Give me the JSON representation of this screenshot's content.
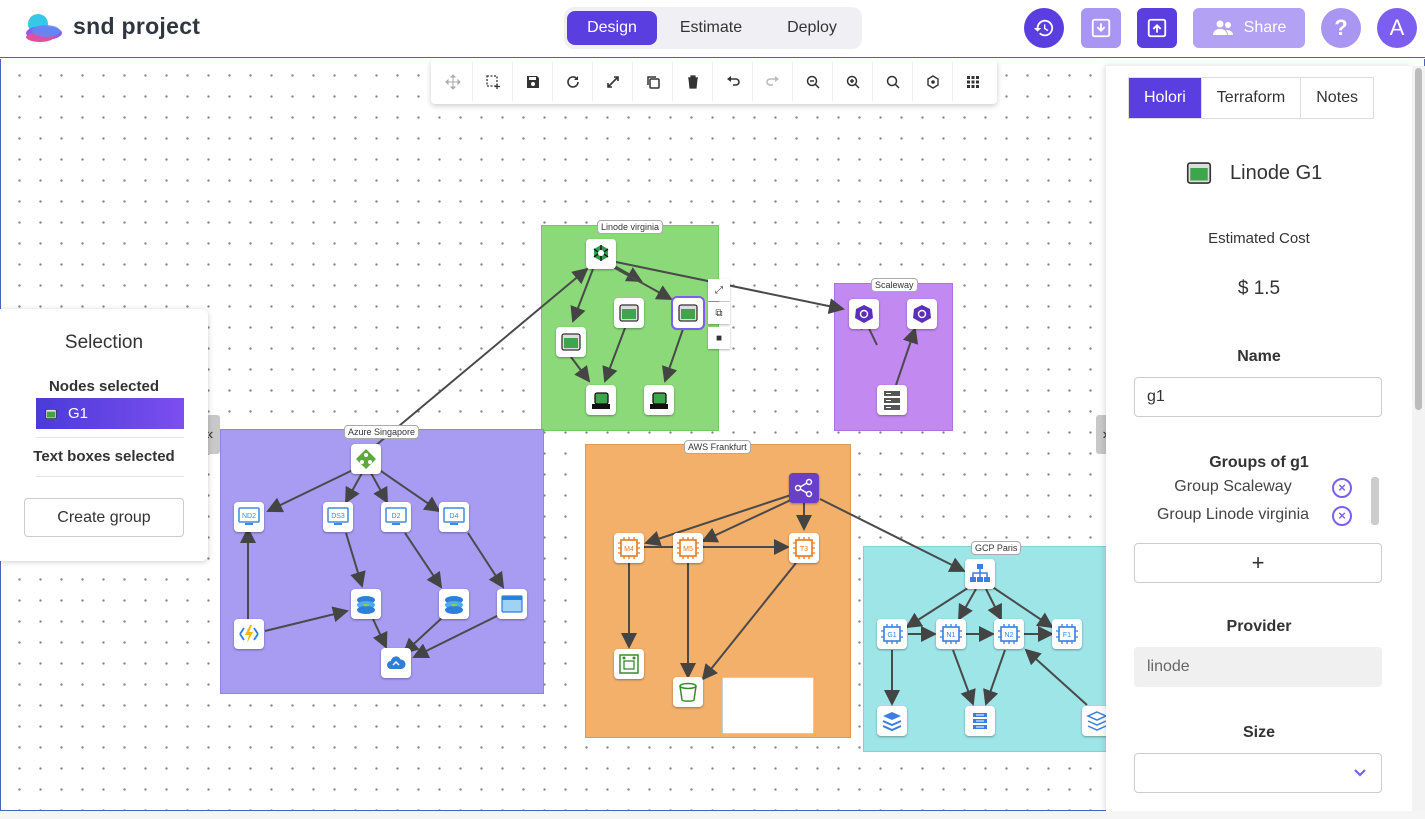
{
  "header": {
    "app_title": "snd project",
    "modes": [
      "Design",
      "Estimate",
      "Deploy"
    ],
    "active_mode": "Design",
    "share_label": "Share",
    "help_label": "?",
    "avatar_initial": "A",
    "colors": {
      "accent": "#5a3ee0",
      "accent_light": "#b3a2f3"
    }
  },
  "toolbar": {
    "tools": [
      "move-icon",
      "select-area-icon",
      "save-icon",
      "refresh-icon",
      "expand-icon",
      "copy-icon",
      "trash-icon",
      "undo-icon",
      "redo-icon",
      "zoom-out-icon",
      "zoom-in-icon",
      "search-icon",
      "snap-icon",
      "grid-icon"
    ]
  },
  "groups": [
    {
      "label": "Linode virginia",
      "color": "#8cd97a"
    },
    {
      "label": "Scaleway",
      "color": "#c289f0"
    },
    {
      "label": "Azure Singapore",
      "color": "#a79bf2"
    },
    {
      "label": "AWS Frankfurt",
      "color": "#f2b06b"
    },
    {
      "label": "GCP Paris",
      "color": "#9ee5e8"
    }
  ],
  "nodes": {
    "azure": [
      "ND2",
      "DS3",
      "D2",
      "D4"
    ],
    "aws": [
      "M4",
      "M5",
      "T3"
    ],
    "gcp": [
      "G1",
      "N1",
      "N2",
      "F1"
    ]
  },
  "selection": {
    "title": "Selection",
    "nodes_heading": "Nodes selected",
    "selected_node": "G1",
    "textboxes_heading": "Text boxes selected",
    "create_group_label": "Create group",
    "collapse_icon": "«",
    "expand_icon": "»"
  },
  "inspector": {
    "tabs": [
      "Holori",
      "Terraform",
      "Notes"
    ],
    "active_tab": "Holori",
    "node_title": "Linode G1",
    "estimated_cost_label": "Estimated Cost",
    "estimated_cost_value": "$ 1.5",
    "name_label": "Name",
    "name_value": "g1",
    "groups_label": "Groups of g1",
    "groups": [
      "Group Scaleway",
      "Group Linode virginia"
    ],
    "add_label": "+",
    "provider_label": "Provider",
    "provider_value": "linode",
    "size_label": "Size",
    "size_value": ""
  }
}
